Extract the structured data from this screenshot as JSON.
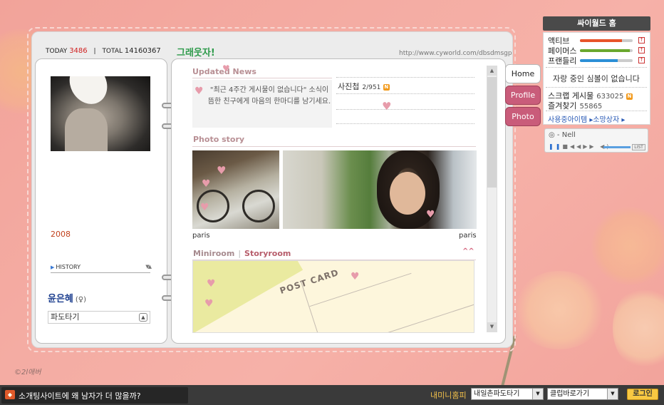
{
  "header": {
    "today_label": "TODAY",
    "today_value": "3486",
    "total_label": "TOTAL",
    "total_value": "14160367",
    "title": "그래웃자!",
    "url": "http://www.cyworld.com/dbsdmsgp"
  },
  "profile": {
    "year": "2008",
    "history_label": "HISTORY",
    "name": "윤은혜",
    "gender_symbol": "(♀)",
    "mood_select": "파도타기"
  },
  "updated_news": {
    "title": "Updated News",
    "message": "\"최근 4주간 게시물이 없습니다\" 소식이 뜸한 친구에게 마음의 한마디를 남기세요.",
    "album_label": "사진첩",
    "album_count": "2/951",
    "new_badge": "N"
  },
  "photo_story": {
    "title": "Photo story",
    "captions": [
      "paris",
      "paris"
    ]
  },
  "miniroom": {
    "tab_miniroom": "Miniroom",
    "tab_separator": "|",
    "tab_storyroom": "Storyroom",
    "collapse": "^^",
    "postcard_text": "POST CARD"
  },
  "nav_tabs": [
    "Home",
    "Profile",
    "Photo"
  ],
  "sidebar": {
    "header": "싸이월드 홈",
    "stats": [
      {
        "label": "액티브",
        "level": 0.8,
        "color": "#e8542a"
      },
      {
        "label": "페이머스",
        "level": 0.95,
        "color": "#6aa82e"
      },
      {
        "label": "프랜들리",
        "level": 0.72,
        "color": "#2b8fd6"
      }
    ],
    "stat_up_icon": "↑",
    "mood": "자랑 중인 심볼이 없습니다",
    "scrap_label": "스크랩 게시물",
    "scrap_count": "633025",
    "fav_label": "즐겨찾기",
    "fav_count": "55865",
    "items_link": "사용중아이템 ▸소망상자 ▸"
  },
  "player": {
    "track": "- Nell",
    "list_label": "LIST"
  },
  "signature": "©2l애버",
  "bottom_bar": {
    "news": "소개팅사이트에 왜 남자가 더 많을까?",
    "my_minihompy": "내미니홈피",
    "select1": "내일촌파도타기",
    "select2": "클럽바로가기",
    "login": "로그인"
  }
}
